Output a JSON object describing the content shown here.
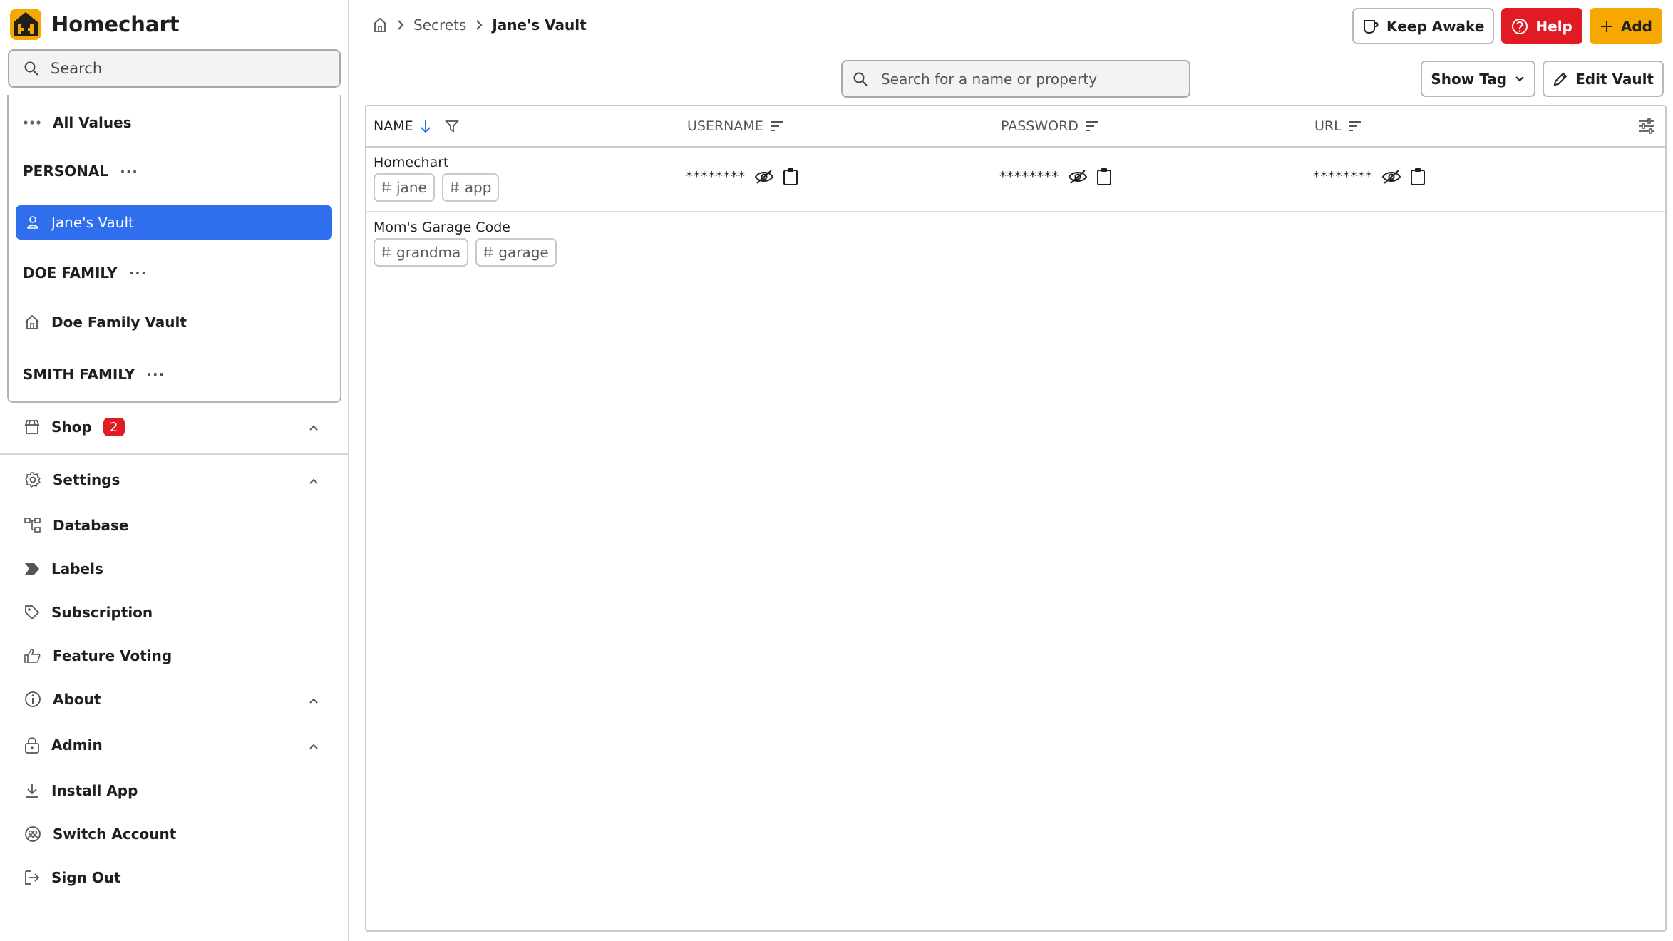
{
  "app": {
    "title": "Homechart",
    "brand_color": "#f6a800",
    "accent_color": "#2f6fed"
  },
  "sidebar": {
    "search_placeholder": "Search",
    "all_values": "All Values",
    "personal_label": "PERSONAL",
    "personal_vault": "Jane's Vault",
    "doe_family_label": "DOE FAMILY",
    "doe_family_vault": "Doe Family Vault",
    "smith_family_label": "SMITH FAMILY",
    "more_dots": "···",
    "shop": {
      "label": "Shop",
      "badge": "2"
    },
    "settings": "Settings",
    "database": "Database",
    "labels": "Labels",
    "subscription": "Subscription",
    "feature_voting": "Feature Voting",
    "about": "About",
    "admin": "Admin",
    "install_app": "Install App",
    "switch_account": "Switch Account",
    "sign_out": "Sign Out"
  },
  "breadcrumb": {
    "home_icon": "home-icon",
    "secrets": "Secrets",
    "current": "Jane's Vault"
  },
  "header_buttons": {
    "keep_awake": "Keep Awake",
    "help": "Help",
    "add": "Add",
    "help_color": "#e01b24"
  },
  "toolbar": {
    "search_placeholder": "Search for a name or property",
    "show_tag": "Show Tag",
    "edit_vault": "Edit Vault"
  },
  "table": {
    "columns": [
      {
        "label": "NAME",
        "sort": "descending"
      },
      {
        "label": "USERNAME"
      },
      {
        "label": "PASSWORD"
      },
      {
        "label": "URL"
      }
    ],
    "rows": [
      {
        "name": "Homechart",
        "tags": [
          "jane",
          "app"
        ],
        "username": "********",
        "password": "********",
        "url": "********"
      },
      {
        "name": "Mom's Garage Code",
        "tags": [
          "grandma",
          "garage"
        ]
      }
    ]
  }
}
